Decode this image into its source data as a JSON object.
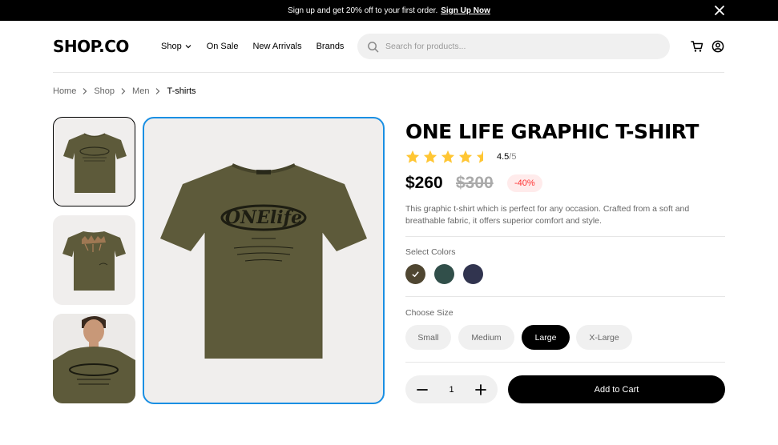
{
  "announcement": {
    "text": "Sign up and get 20% off to your first order.",
    "link": "Sign Up Now"
  },
  "header": {
    "logo": "SHOP.CO",
    "nav": [
      "Shop",
      "On Sale",
      "New Arrivals",
      "Brands"
    ],
    "search_placeholder": "Search for products..."
  },
  "breadcrumb": [
    "Home",
    "Shop",
    "Men",
    "T-shirts"
  ],
  "product": {
    "title": "ONE LIFE GRAPHIC T-SHIRT",
    "rating": 4.5,
    "rating_value": "4.5",
    "rating_max": "/5",
    "price": "$260",
    "old_price": "$300",
    "discount": "-40%",
    "description": "This graphic t-shirt which is perfect for any occasion. Crafted from a soft and breathable fabric, it offers superior comfort and style.",
    "graphic_text": "ONElife"
  },
  "colors": {
    "label": "Select Colors",
    "options": [
      {
        "name": "olive",
        "hex": "#4f4631",
        "selected": true
      },
      {
        "name": "teal",
        "hex": "#314f4a",
        "selected": false
      },
      {
        "name": "navy",
        "hex": "#31344f",
        "selected": false
      }
    ]
  },
  "sizes": {
    "label": "Choose Size",
    "options": [
      "Small",
      "Medium",
      "Large",
      "X-Large"
    ],
    "selected": "Large"
  },
  "cart": {
    "quantity": "1",
    "add_label": "Add to Cart"
  },
  "theme": {
    "accent_focus": "#1a8fe3",
    "star": "#ffc633",
    "discount": "#ff3333",
    "shirt": "#5d5a3a"
  }
}
